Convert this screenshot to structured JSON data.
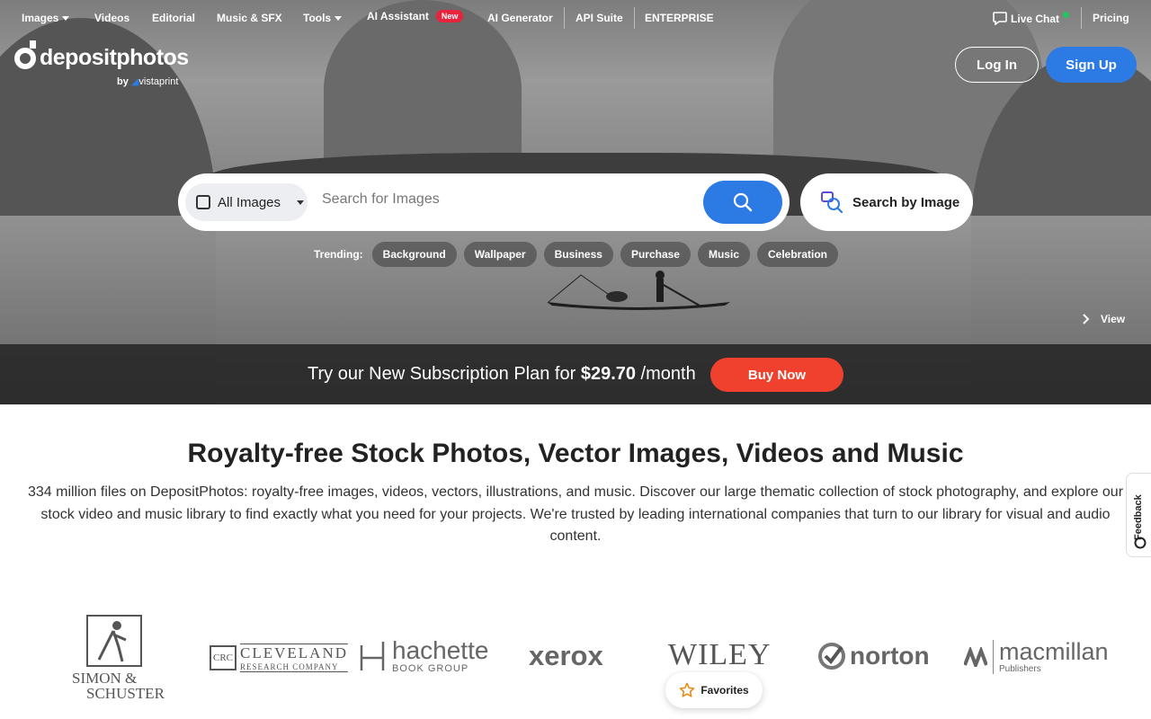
{
  "nav": {
    "items": [
      {
        "label": "Images",
        "dropdown": true
      },
      {
        "label": "Videos"
      },
      {
        "label": "Editorial"
      },
      {
        "label": "Music & SFX"
      },
      {
        "label": "Tools",
        "dropdown": true
      },
      {
        "label": "AI Assistant",
        "badge": "New"
      },
      {
        "label": "AI Generator"
      },
      {
        "label": "API Suite"
      },
      {
        "label": "ENTERPRISE"
      }
    ],
    "live_chat": "Live Chat",
    "pricing": "Pricing"
  },
  "logo": {
    "word": "depositphotos",
    "by": "by",
    "partner": "vistaprint"
  },
  "auth": {
    "login": "Log In",
    "signup": "Sign Up"
  },
  "search": {
    "type_selected": "All Images",
    "placeholder": "Search for Images",
    "search_by_image": "Search by Image"
  },
  "trending": {
    "label": "Trending:",
    "chips": [
      "Background",
      "Wallpaper",
      "Business",
      "Purchase",
      "Music",
      "Celebration"
    ]
  },
  "hero": {
    "view_label": "View"
  },
  "promo": {
    "text_before": "Try our New Subscription Plan for ",
    "price": "$29.70",
    "text_after": " /month",
    "button": "Buy Now"
  },
  "main": {
    "title": "Royalty-free Stock Photos, Vector Images, Videos and Music",
    "description": "334 million files on DepositPhotos: royalty-free images, videos, vectors, illustrations, and music. Discover our large thematic collection of stock photography, and explore our stock video and music library to find exactly what you need for your projects. We're trusted by leading international companies that turn to our library for visual and audio content."
  },
  "feedback": "Feedback",
  "brands": {
    "simon_line1": "SIMON &",
    "simon_line2": "SCHUSTER",
    "crc": "CRC",
    "cleveland_line1": "CLEVELAND",
    "cleveland_line2": "RESEARCH COMPANY",
    "hachette_line1": "hachette",
    "hachette_line2": "BOOK GROUP",
    "xerox": "xerox",
    "wiley": "WILEY",
    "norton": "norton",
    "macmillan_line1": "macmillan",
    "macmillan_line2": "Publishers"
  },
  "favorites": "Favorites",
  "colors": {
    "accent": "#2c7be5",
    "buy": "#f0412f",
    "new_badge": "#e8233b",
    "online_dot": "#22c55e"
  }
}
